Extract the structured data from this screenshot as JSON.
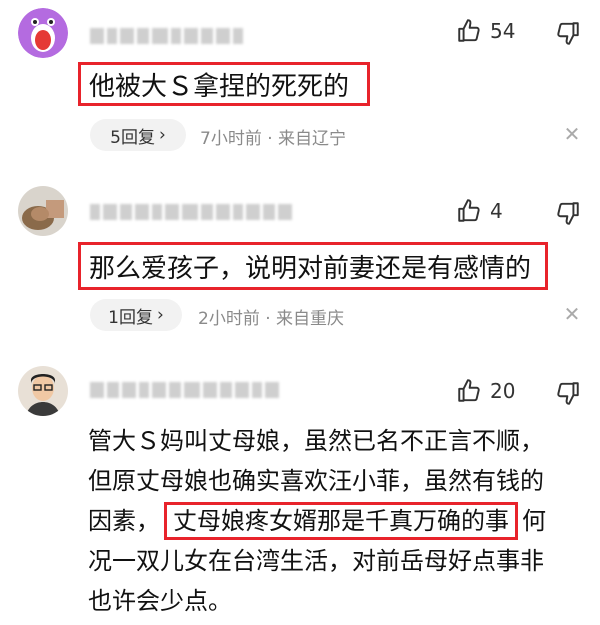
{
  "comments": [
    {
      "likes": "54",
      "text": "他被大Ｓ拿捏的死死的",
      "replies_label": "5回复",
      "time": "7小时前",
      "location": "来自辽宁"
    },
    {
      "likes": "4",
      "text": "那么爱孩子，说明对前妻还是有感情的",
      "replies_label": "1回复",
      "time": "2小时前",
      "location": "来自重庆"
    },
    {
      "likes": "20",
      "lines": [
        "管大Ｓ妈叫丈母娘，虽然已名不正言不顺，",
        "但原丈母娘也确实喜欢汪小菲，虽然有钱的",
        "因素，",
        "丈母娘疼女婿那是千真万确的事",
        "何",
        "况一双儿女在台湾生活，对前岳母好点事非",
        "也许会少点。"
      ]
    }
  ],
  "separator": " · ",
  "colors": {
    "highlight_border": "#e8232b",
    "meta_text": "#8a8a8a",
    "reply_bg": "#f2f2f2"
  },
  "icons": {
    "like": "thumbs-up-icon",
    "dislike": "thumbs-down-icon",
    "close": "close-icon",
    "chevron": "chevron-right-icon"
  }
}
